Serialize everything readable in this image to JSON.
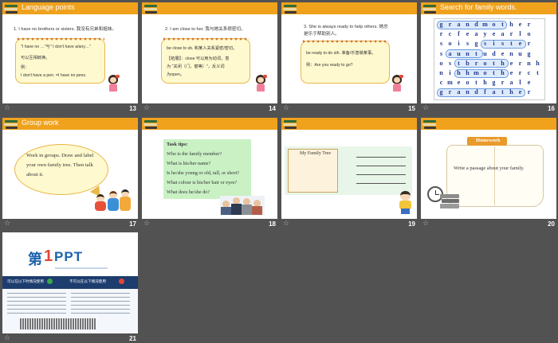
{
  "slides": {
    "s13": {
      "number": "13",
      "title": "Language points",
      "line1": "1. I have no brothers or sisters. 我没有兄弟和姐妹。",
      "b1": "\"I have no …\"与\" I don't have a/any…\"",
      "b2": "可以互相转换。",
      "b3": "例：",
      "b4": "I don't have a pen. =I have no pens."
    },
    "s14": {
      "number": "14",
      "line1": "2. I am close to her. 我与她关系很密切。",
      "b1": "be close to sb. 和某人关系紧密/密切。",
      "b2": "【拓展】：close 可以用为动词，意",
      "b3": "为 \"关闭（门，窗等）\"，反义词",
      "b4": "为open。"
    },
    "s15": {
      "number": "15",
      "line1": "3. She is always ready to help others. 她总",
      "line2": "是乐于帮助别人。",
      "b1": "be ready to do sth. 准备/乐意做某事。",
      "b2": "例：Are you ready to go?"
    },
    "s16": {
      "number": "16",
      "title": "Search for family words.",
      "rows": [
        "grandmother",
        "rcfeayearlo",
        "soisgsister",
        "sauntudenug",
        "ostbrothernh",
        "nihhmotherct",
        "cmeothgrale",
        "grandfather"
      ]
    },
    "s17": {
      "number": "17",
      "title": "Group work",
      "b1": "Work in groups. Draw and label",
      "b2": "your own family tree. Then talk",
      "b3": "about it."
    },
    "s18": {
      "number": "18",
      "tips_title": "Task tips:",
      "tips": [
        "Who is the family member?",
        "What is his/her name?",
        "Is he/she young or old, tall, or short?",
        "What colour is his/her hair or eyes?",
        "What does he/she do?"
      ]
    },
    "s19": {
      "number": "19",
      "box_title": "My Family Tree"
    },
    "s20": {
      "number": "20",
      "tab": "Homework",
      "text": "Write a passage about your family."
    },
    "s21": {
      "number": "21",
      "logo_a": "第",
      "logo_b": "1",
      "logo_c": "PPT",
      "col1": "可以在以下时情况使用",
      "col2": "不可以在以下情况使用"
    }
  },
  "star_glyph": "☆",
  "colors": {
    "background": "#525252",
    "title_bar": "#f0a21c",
    "bubble_fill": "#fff9cf",
    "bubble_border": "#e8b84a",
    "grid_text": "#243a8c",
    "tips_fill": "#c9f1c4",
    "ppt_blue": "#1d63ad"
  }
}
